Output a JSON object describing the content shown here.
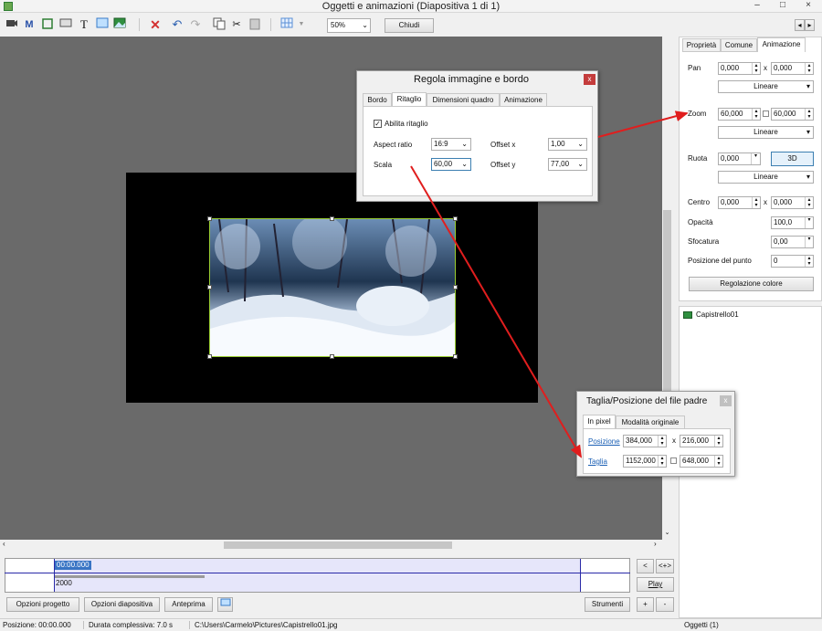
{
  "window": {
    "title": "Oggetti e animazioni  (Diapositiva 1 di 1)",
    "minimize": "–",
    "maximize": "□",
    "close": "×"
  },
  "toolbar": {
    "m_label": "M",
    "t_label": "T",
    "zoom": "50%",
    "close_label": "Chiudi",
    "prev": "◂",
    "next": "▸"
  },
  "right_panel": {
    "tabs": [
      "Proprietà",
      "Comune",
      "Animazione"
    ],
    "pan": {
      "label": "Pan",
      "x": "0,000",
      "y": "0,000",
      "x_sep": "x",
      "mode": "Lineare"
    },
    "zoom": {
      "label": "Zoom",
      "x": "60,000",
      "y": "60,000",
      "mode": "Lineare"
    },
    "ruota": {
      "label": "Ruota",
      "value": "0,000",
      "btn3d": "3D",
      "mode": "Lineare"
    },
    "centro": {
      "label": "Centro",
      "x": "0,000",
      "y": "0,000",
      "x_sep": "x"
    },
    "opacita": {
      "label": "Opacità",
      "value": "100,0"
    },
    "sfocatura": {
      "label": "Sfocatura",
      "value": "0,00"
    },
    "posizione_punto": {
      "label": "Posizione del punto",
      "value": "0"
    },
    "color_btn": "Regolazione colore"
  },
  "object_list": {
    "items": [
      "Capistrello01"
    ]
  },
  "dialog": {
    "title": "Regola immagine e bordo",
    "close": "x",
    "tabs": [
      "Bordo",
      "Ritaglio",
      "Dimensioni quadro",
      "Animazione"
    ],
    "enable_crop": "Abilita ritaglio",
    "aspect_label": "Aspect ratio",
    "aspect_value": "16:9",
    "offsetx_label": "Offset x",
    "offsetx_value": "1,00",
    "scala_label": "Scala",
    "scala_value": "60,00",
    "offsety_label": "Offset y",
    "offsety_value": "77,00"
  },
  "parent_dialog": {
    "title": "Taglia/Posizione del file padre",
    "close": "x",
    "tabs": [
      "In pixel",
      "Modalità originale"
    ],
    "posizione_label": "Posizione",
    "pos_x": "384,000",
    "pos_sep": "x",
    "pos_y": "216,000",
    "taglia_label": "Taglia",
    "size_w": "1152,000",
    "size_h": "648,000"
  },
  "timeline": {
    "time": "00:00.000",
    "value": "2000",
    "btn_left": "<",
    "btn_right": "<+>",
    "play": "Play"
  },
  "bottom_buttons": {
    "opzioni_progetto": "Opzioni progetto",
    "opzioni_diapositiva": "Opzioni diapositiva",
    "anteprima": "Anteprima",
    "strumenti": "Strumenti",
    "plus": "+",
    "minus": "-"
  },
  "status": {
    "posizione": "Posizione:  00:00.000",
    "durata": "Durata complessiva:  7.0 s",
    "file": "C:\\Users\\Carmelo\\Pictures\\Capistrello01.jpg",
    "oggetti": "Oggetti (1)"
  }
}
